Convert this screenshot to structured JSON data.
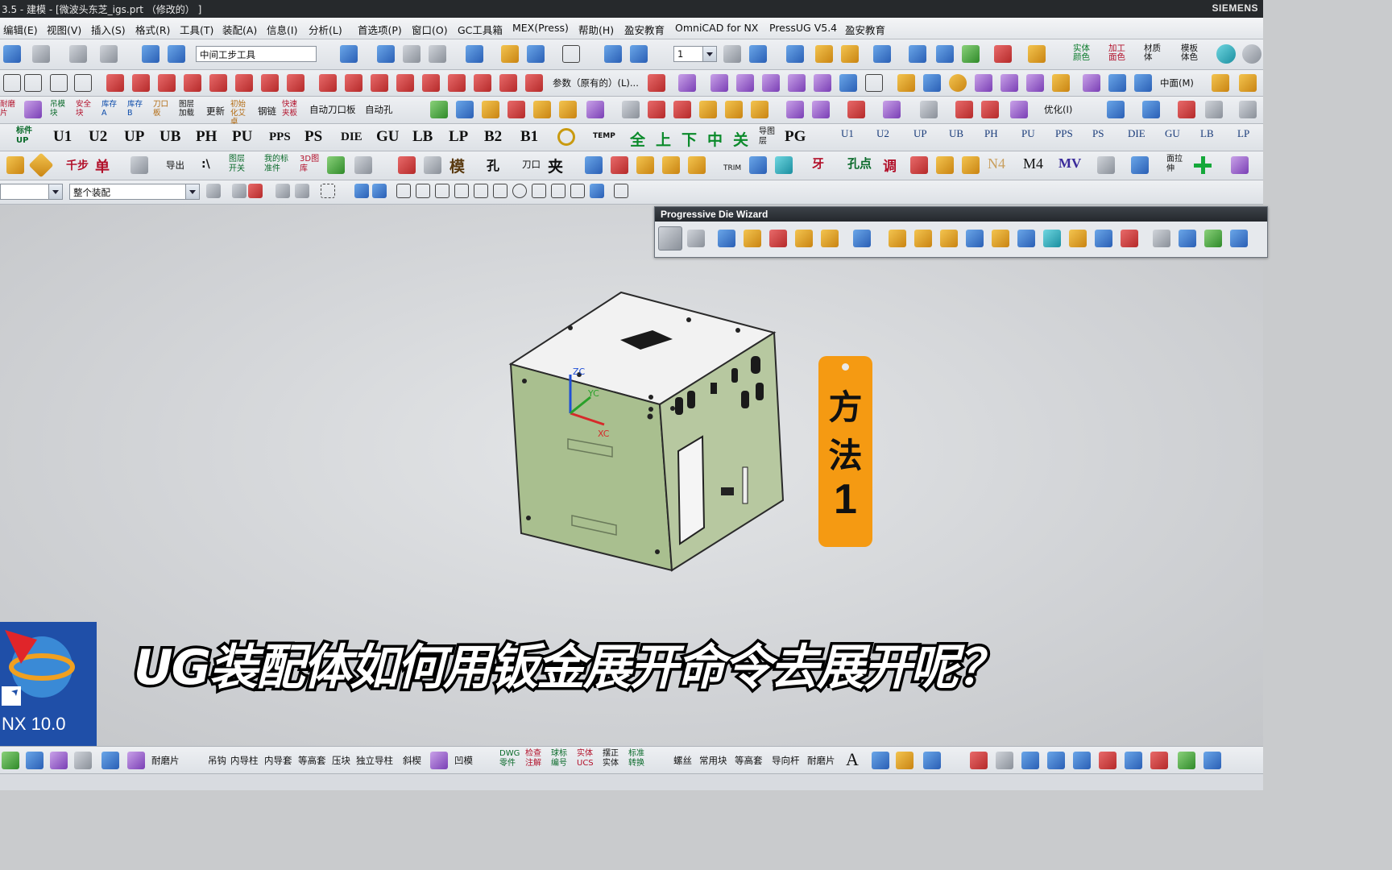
{
  "window": {
    "title": "3.5 - 建模 - [微波头东芝_igs.prt （修改的） ]",
    "brand": "SIEMENS"
  },
  "menu": [
    "编辑(E)",
    "视图(V)",
    "插入(S)",
    "格式(R)",
    "工具(T)",
    "装配(A)",
    "信息(I)",
    "分析(L)",
    "首选项(P)",
    "窗口(O)",
    "GC工具箱",
    "MEX(Press)",
    "帮助(H)",
    "盈安教育",
    "OmniCAD for NX",
    "PressUG V5.4",
    "盈安教育"
  ],
  "toolbar1": {
    "filter_value": "中间工步工具",
    "layer_value": "1",
    "labels": {
      "entity_color": "实体颜色",
      "process_color": "加工面色",
      "material": "材质体",
      "template": "模板体色"
    }
  },
  "toolbar2": {
    "labels": {
      "params": "参数（原有的）(L)...",
      "middle": "中面(M)"
    }
  },
  "toolbar3": {
    "labels": {
      "update": "更新",
      "auto_knife": "自动刀口板",
      "auto_hole": "自动孔",
      "optimize": "优化(I)"
    },
    "mini": [
      "耐磨片",
      "吊模块",
      "安全块",
      "库存A",
      "库存B",
      "刀口板",
      "图层加载",
      "初始化艾卓",
      "钢链",
      "快速夹板"
    ]
  },
  "toolbar4": {
    "codes": [
      "U1",
      "U2",
      "UP",
      "UB",
      "PH",
      "PU",
      "PPS",
      "PS",
      "DIE",
      "GU",
      "LB",
      "LP",
      "B2",
      "B1"
    ],
    "chinese": [
      "全",
      "上",
      "下",
      "中",
      "关"
    ],
    "extra": [
      "TEMP",
      "导图层",
      "PG"
    ],
    "codes2": [
      "U1",
      "U2",
      "UP",
      "UB",
      "PH",
      "PU",
      "PPS",
      "PS",
      "DIE",
      "GU",
      "LB",
      "LP"
    ],
    "label_up": "标件UP"
  },
  "toolbar5": {
    "labels": {
      "thousand": "千步",
      "single": "单",
      "export": "导出",
      "layer": "图层开关",
      "mystd": "我的标准件",
      "lib3d": "3D图库",
      "die": "模",
      "hole": "孔",
      "knife": "刀口",
      "clamp": "夹",
      "trim": "TRIM",
      "tooth": "牙",
      "holepoint": "孔点",
      "adjust": "调",
      "n4": "N4",
      "m4": "M4",
      "mv": "MV",
      "pull": "面拉伸"
    }
  },
  "selection_bar": {
    "filter_value": "",
    "scope_value": "整个装配"
  },
  "pdw": {
    "title": "Progressive Die Wizard"
  },
  "axes": {
    "zc": "ZC",
    "yc": "YC",
    "xc": "XC"
  },
  "tag": {
    "line1": "方",
    "line2": "法",
    "line3": "1"
  },
  "caption": "UG装配体如何用钣金展开命令去展开呢？",
  "desktop_icon": {
    "label": "NX 10.0"
  },
  "bottom": {
    "labels": [
      "耐磨片",
      "吊钩",
      "内导柱",
      "内导套",
      "等高套",
      "压块",
      "独立导柱",
      "斜楔",
      "凹模",
      "DWG零件",
      "检查注解",
      "球标编号",
      "实体UCS",
      "摆正实体",
      "标准转换",
      "螺丝",
      "常用块",
      "等高套",
      "导向杆",
      "耐磨片"
    ]
  },
  "colors": {
    "panel_green": "#a9bf8f",
    "tag_orange": "#f59a12",
    "title_bg": "#26292c"
  }
}
